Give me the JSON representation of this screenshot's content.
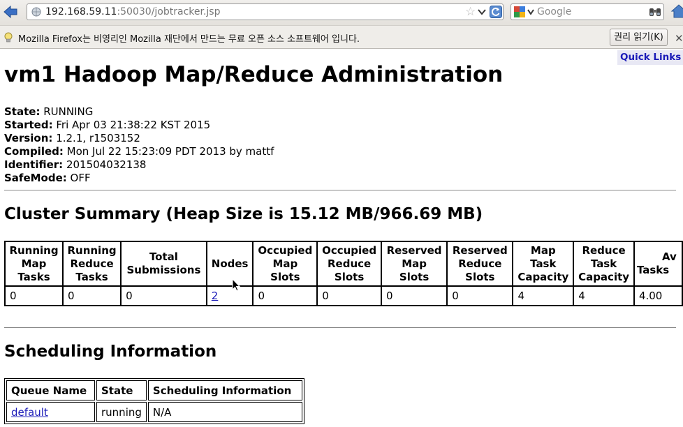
{
  "browser": {
    "url_host": "192.168.59.11",
    "url_path": ":50030/jobtracker.jsp",
    "search_placeholder": "Google",
    "notification_text": "Mozilla Firefox는 비영리인 Mozilla 재단에서 만드는 무료 오픈 소스 소프트웨어 입니다.",
    "rights_button": "권리 읽기(K)"
  },
  "quick_links": "Quick Links",
  "page_title": "vm1 Hadoop Map/Reduce Administration",
  "info": [
    {
      "label": "State:",
      "value": "RUNNING"
    },
    {
      "label": "Started:",
      "value": "Fri Apr 03 21:38:22 KST 2015"
    },
    {
      "label": "Version:",
      "value": "1.2.1, r1503152"
    },
    {
      "label": "Compiled:",
      "value": "Mon Jul 22 15:23:09 PDT 2013 by mattf"
    },
    {
      "label": "Identifier:",
      "value": "201504032138"
    },
    {
      "label": "SafeMode:",
      "value": "OFF"
    }
  ],
  "cluster_summary": {
    "heading": "Cluster Summary (Heap Size is 15.12 MB/966.69 MB)",
    "headers": [
      [
        "Running",
        "Map",
        "Tasks"
      ],
      [
        "Running",
        "Reduce",
        "Tasks"
      ],
      [
        "Total",
        "Submissions"
      ],
      [
        "Nodes"
      ],
      [
        "Occupied",
        "Map",
        "Slots"
      ],
      [
        "Occupied",
        "Reduce",
        "Slots"
      ],
      [
        "Reserved",
        "Map",
        "Slots"
      ],
      [
        "Reserved",
        "Reduce",
        "Slots"
      ],
      [
        "Map",
        "Task",
        "Capacity"
      ],
      [
        "Reduce",
        "Task",
        "Capacity"
      ],
      [
        "Av",
        "Tasks"
      ]
    ],
    "values": [
      "0",
      "0",
      "0",
      "2",
      "0",
      "0",
      "0",
      "0",
      "4",
      "4",
      "4.00"
    ]
  },
  "scheduling": {
    "heading": "Scheduling Information",
    "headers": [
      "Queue Name",
      "State",
      "Scheduling Information"
    ],
    "rows": [
      [
        "default",
        "running",
        "N/A"
      ]
    ]
  },
  "icons": {
    "back": "back-arrow-icon",
    "page": "globe-icon",
    "bookmark": "star-icon",
    "reload": "reload-icon",
    "search_engine": "google-icon",
    "search_go": "binoculars-icon",
    "home": "home-icon",
    "notification": "lightbulb-icon",
    "close": "close-icon",
    "cursor": "mouse-pointer-icon"
  },
  "colors": {
    "link": "#1a1ab8",
    "quick_links_bg": "#e8e8f4"
  }
}
